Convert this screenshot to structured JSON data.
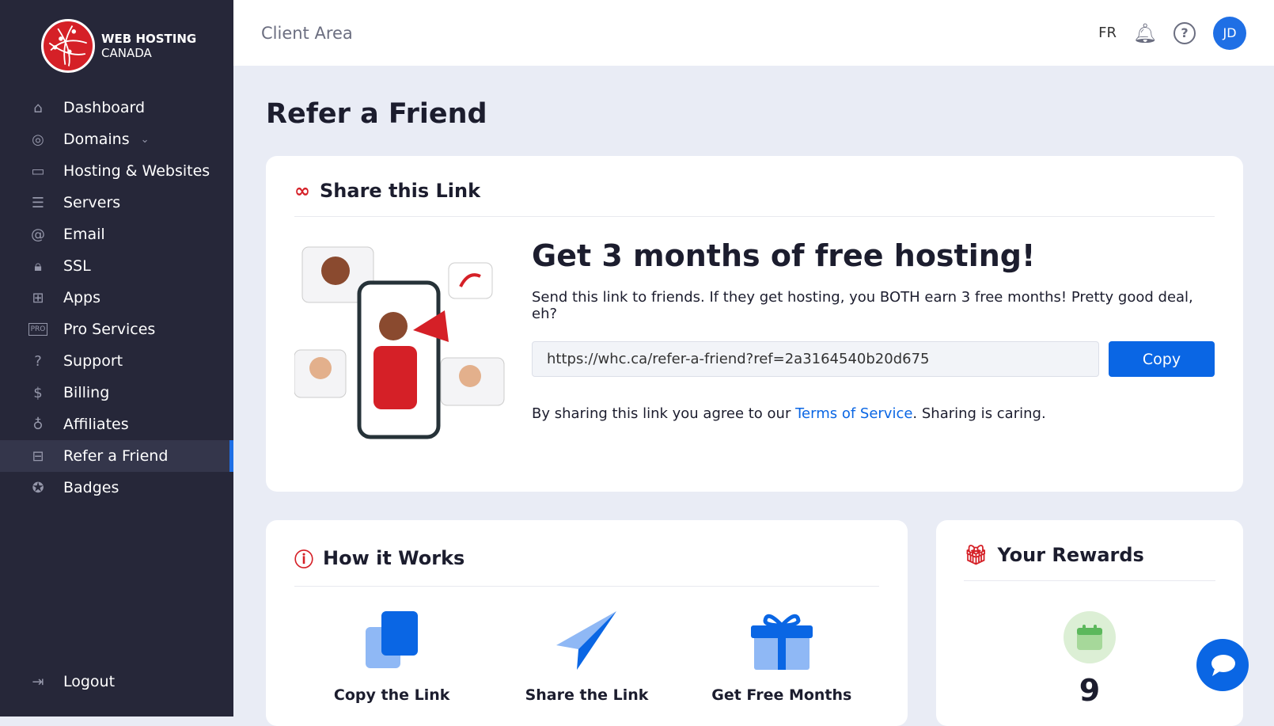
{
  "brand": {
    "line1": "WEB HOSTING",
    "line2": "CANADA"
  },
  "sidebar": {
    "items": [
      {
        "label": "Dashboard",
        "icon": "home-icon",
        "glyph": "⌂"
      },
      {
        "label": "Domains",
        "icon": "globe-icon",
        "glyph": "◎"
      },
      {
        "label": "Hosting & Websites",
        "icon": "browser-icon",
        "glyph": "▭"
      },
      {
        "label": "Servers",
        "icon": "server-icon",
        "glyph": "☰"
      },
      {
        "label": "Email",
        "icon": "at-icon",
        "glyph": "@"
      },
      {
        "label": "SSL",
        "icon": "lock-icon",
        "glyph": "🔒︎"
      },
      {
        "label": "Apps",
        "icon": "apps-icon",
        "glyph": "⊞"
      },
      {
        "label": "Pro Services",
        "icon": "pro-icon",
        "glyph": "PRO"
      },
      {
        "label": "Support",
        "icon": "support-icon",
        "glyph": "?"
      },
      {
        "label": "Billing",
        "icon": "dollar-icon",
        "glyph": "$"
      },
      {
        "label": "Affiliates",
        "icon": "money-bag-icon",
        "glyph": "♁"
      },
      {
        "label": "Refer a Friend",
        "icon": "gift-icon",
        "glyph": "⊟"
      },
      {
        "label": "Badges",
        "icon": "badge-icon",
        "glyph": "✪"
      }
    ],
    "active": "Refer a Friend",
    "logout": "Logout"
  },
  "header": {
    "title": "Client Area",
    "lang": "FR",
    "avatar": "JD"
  },
  "page": {
    "title": "Refer a Friend"
  },
  "share": {
    "title": "Share this Link",
    "headline": "Get 3 months of free hosting!",
    "description": "Send this link to friends. If they get hosting, you BOTH earn 3 free months! Pretty good deal, eh?",
    "link": "https://whc.ca/refer-a-friend?ref=2a3164540b20d675",
    "copy": "Copy",
    "agree_pre": "By sharing this link you agree to our ",
    "agree_link": "Terms of Service",
    "agree_post": ". Sharing is caring."
  },
  "how": {
    "title": "How it Works",
    "steps": [
      {
        "label": "Copy the Link"
      },
      {
        "label": "Share the Link"
      },
      {
        "label": "Get Free Months"
      }
    ]
  },
  "rewards": {
    "title": "Your Rewards",
    "count": "9"
  },
  "colors": {
    "sidebar": "#262739",
    "accent": "#0a66e4",
    "brand_red": "#d52027"
  }
}
